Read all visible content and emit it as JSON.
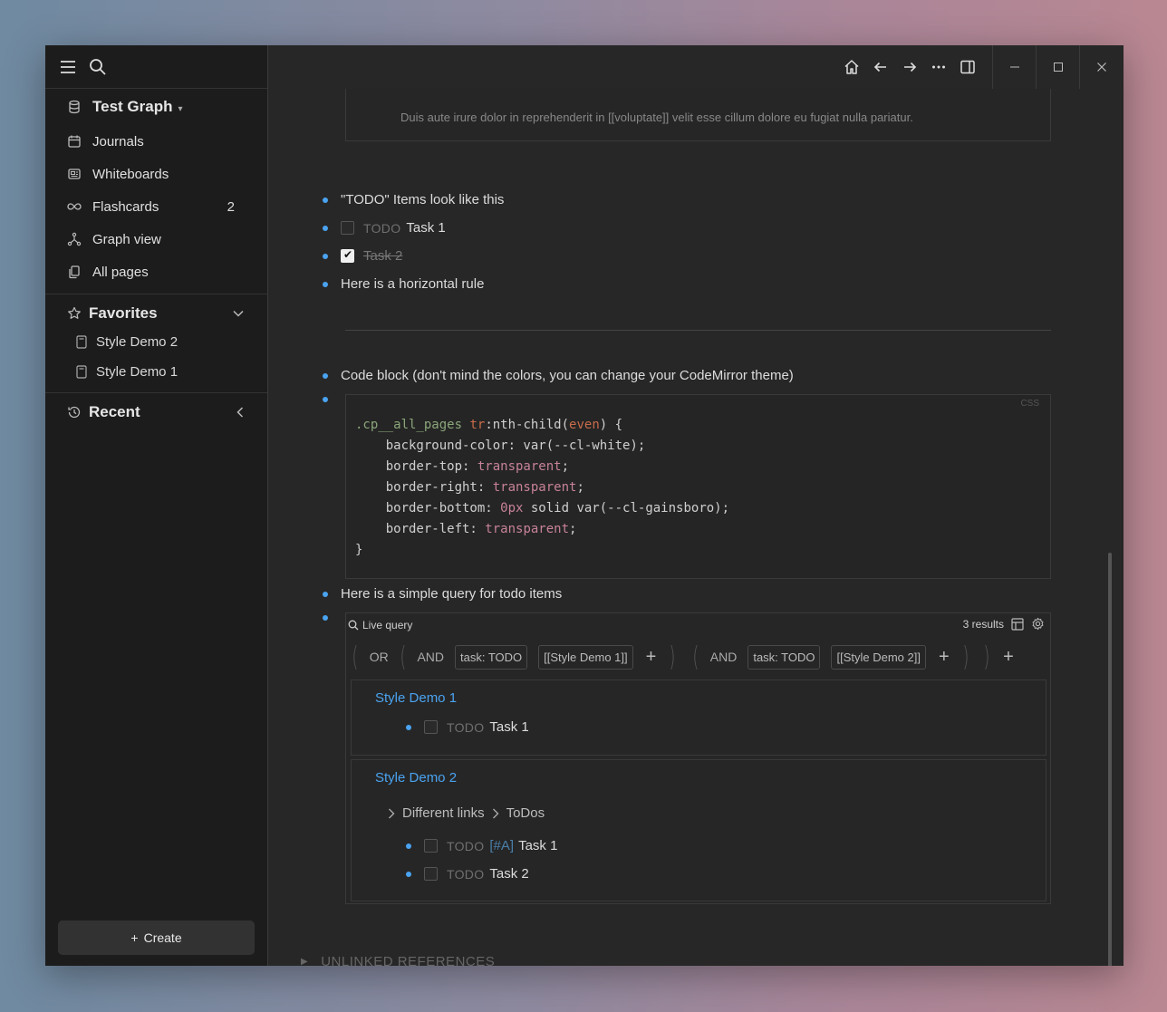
{
  "sidebar": {
    "graph_name": "Test Graph",
    "nav": [
      {
        "label": "Journals",
        "icon": "calendar-icon"
      },
      {
        "label": "Whiteboards",
        "icon": "whiteboard-icon"
      },
      {
        "label": "Flashcards",
        "icon": "infinity-icon",
        "count": "2"
      },
      {
        "label": "Graph view",
        "icon": "graph-icon"
      },
      {
        "label": "All pages",
        "icon": "pages-icon"
      }
    ],
    "favorites_label": "Favorites",
    "favorites": [
      "Style Demo 2",
      "Style Demo 1"
    ],
    "recent_label": "Recent",
    "create_label": "Create"
  },
  "content": {
    "top_strip_text": "Duis aute irure dolor in reprehenderit in [[voluptate]] velit esse cillum dolore eu fugiat nulla pariatur.",
    "todo_intro": "\"TODO\" Items look like this",
    "task1_kw": "TODO",
    "task1": "Task 1",
    "task2": "Task 2",
    "hr_label": "Here is a horizontal rule",
    "code_label": "Code block (don't mind the colors, you can change your CodeMirror theme)",
    "code_lang": "CSS",
    "code_lines": {
      "l1a": ".cp__all_pages",
      "l1b": "tr",
      "l1c": ":nth-child(",
      "l1d": "even",
      "l1e": ") {",
      "l2": "    background-color: var(--cl-white);",
      "l3a": "    border-top: ",
      "l3b": "transparent",
      "l3c": ";",
      "l4a": "    border-right: ",
      "l4b": "transparent",
      "l4c": ";",
      "l5a": "    border-bottom: ",
      "l5b": "0px",
      "l5c": " solid var(--cl-gainsboro);",
      "l6a": "    border-left: ",
      "l6b": "transparent",
      "l6c": ";",
      "l7": "}"
    },
    "query_label": "Here is a simple query for todo items",
    "query": {
      "title": "Live query",
      "results": "3 results",
      "or": "OR",
      "and1": "AND",
      "chip1": "task: TODO",
      "chip2": "[[Style Demo 1]]",
      "and2": "AND",
      "chip3": "task: TODO",
      "chip4": "[[Style Demo 2]]",
      "plus": "+",
      "group1_title": "Style Demo 1",
      "group1_task_kw": "TODO",
      "group1_task": "Task 1",
      "group2_title": "Style Demo 2",
      "crumb1": "Different links",
      "crumb2": "ToDos",
      "group2_task1_kw": "TODO",
      "group2_task1_tag": "[#A]",
      "group2_task1": "Task 1",
      "group2_task2_kw": "TODO",
      "group2_task2": "Task 2"
    },
    "unlinked": "UNLINKED REFERENCES",
    "help": "?"
  }
}
